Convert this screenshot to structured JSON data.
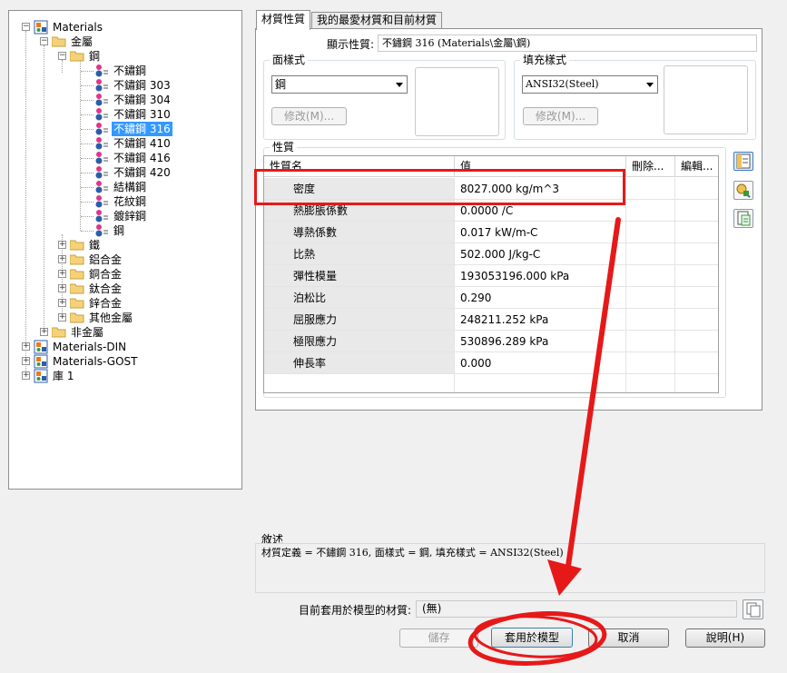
{
  "tree": {
    "root1": "Materials",
    "metals": "金屬",
    "steel": "鋼",
    "steel_items": [
      "不鏽鋼",
      "不鏽鋼 303",
      "不鏽鋼 304",
      "不鏽鋼 310",
      "不鏽鋼 316",
      "不鏽鋼 410",
      "不鏽鋼 416",
      "不鏽鋼 420",
      "結構鋼",
      "花紋鋼",
      "鍍鋅鋼",
      "鋼"
    ],
    "selected": "不鏽鋼 316",
    "metal_folders": [
      "鐵",
      "鋁合金",
      "銅合金",
      "鈦合金",
      "鋅合金",
      "其他金屬"
    ],
    "non_metals": "非金屬",
    "root2": "Materials-DIN",
    "root3": "Materials-GOST",
    "root4": "庫 1"
  },
  "tabs": [
    "材質性質",
    "我的最愛材質和目前材質"
  ],
  "display_property": {
    "label": "顯示性質:",
    "value": "不鏽鋼 316 (Materials\\金屬\\鋼)"
  },
  "face_style": {
    "title": "面樣式",
    "value": "鋼",
    "modify": "修改(M)..."
  },
  "fill_style": {
    "title": "填充樣式",
    "value": "ANSI32(Steel)",
    "modify": "修改(M)..."
  },
  "properties": {
    "title": "性質",
    "columns": [
      "性質名",
      "值",
      "刪除...",
      "編輯..."
    ],
    "rows": [
      {
        "name": "密度",
        "value": "8027.000 kg/m^3"
      },
      {
        "name": "熱膨脹係數",
        "value": "0.0000 /C"
      },
      {
        "name": "導熱係數",
        "value": "0.017 kW/m-C"
      },
      {
        "name": "比熱",
        "value": "502.000 J/kg-C"
      },
      {
        "name": "彈性模量",
        "value": "193053196.000 kPa"
      },
      {
        "name": "泊松比",
        "value": "0.290"
      },
      {
        "name": "屈服應力",
        "value": "248211.252 kPa"
      },
      {
        "name": "極限應力",
        "value": "530896.289 kPa"
      },
      {
        "name": "伸長率",
        "value": "0.000"
      }
    ]
  },
  "description": {
    "title": "敘述",
    "text": "材質定義 = 不鏽鋼 316, 面樣式 = 鋼, 填充樣式 = ANSI32(Steel)"
  },
  "current_model_material": {
    "label": "目前套用於模型的材質:",
    "value": "(無)"
  },
  "buttons": {
    "save": "儲存",
    "apply": "套用於模型",
    "cancel": "取消",
    "help": "說明(H)"
  },
  "colors": {
    "selection": "#3399ff",
    "annotation": "#e61919"
  },
  "icons": [
    "tree-expander-icon",
    "folder-icon",
    "material-icon",
    "new-property-icon",
    "edit-property-icon",
    "copy-property-icon",
    "browse-icon"
  ]
}
